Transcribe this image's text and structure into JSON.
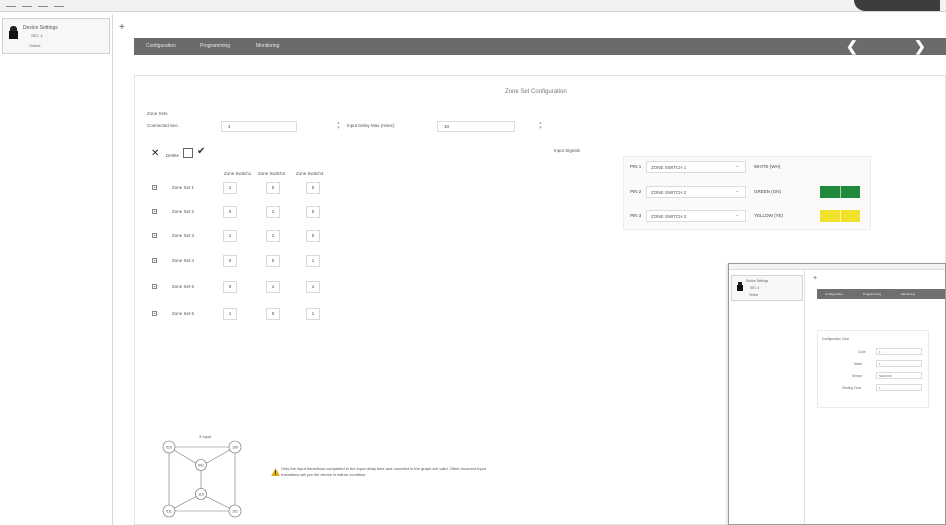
{
  "device": {
    "title": "Device Settings",
    "name": "SEC 4",
    "status": "Online",
    "add": "+"
  },
  "toolbar": {
    "tabs": [
      "Configuration",
      "Programming",
      "Monitoring"
    ],
    "back": "❮",
    "forward": "❯"
  },
  "page": {
    "title": "Zone Set Configuration"
  },
  "zone_sets": {
    "section_label": "Zone Sets",
    "connected_label": "Connected Sec.",
    "connected_value": "4",
    "delay_label": "Input Delay Max (msec)",
    "delay_value": "10",
    "delete_label": "Delete",
    "columns": [
      "Zone Switch1",
      "Zone Switch2",
      "Zone Switch3"
    ],
    "rows": [
      {
        "name": "Zone Set 1",
        "values": [
          "1",
          "0",
          "0"
        ]
      },
      {
        "name": "Zone Set 2",
        "values": [
          "0",
          "1",
          "0"
        ]
      },
      {
        "name": "Zone Set 3",
        "values": [
          "1",
          "1",
          "0"
        ]
      },
      {
        "name": "Zone Set 4",
        "values": [
          "0",
          "0",
          "1"
        ]
      },
      {
        "name": "Zone Set 5",
        "values": [
          "0",
          "1",
          "1"
        ]
      },
      {
        "name": "Zone Set 6",
        "values": [
          "1",
          "0",
          "1"
        ]
      }
    ]
  },
  "input_signals": {
    "label": "Input Signals",
    "rows": [
      {
        "pin": "PIN 1",
        "select": "ZONE SWITCH 1",
        "color": "WHITE (WH)",
        "swatch": null
      },
      {
        "pin": "PIN 2",
        "select": "ZONE SWITCH 2",
        "color": "GREEN (GN)",
        "swatch": "#1f8a3c"
      },
      {
        "pin": "PIN 3",
        "select": "ZONE SWITCH 3",
        "color": "YELLOW (YE)",
        "swatch": "#f2e12a"
      }
    ]
  },
  "diagram": {
    "title": "3 Input",
    "nodes": [
      "010",
      "100",
      "001",
      "110",
      "011",
      "101"
    ]
  },
  "warning": {
    "text": "Only the input transitions completed in the input delay time and mounted in the graph are valid. Other incorrect input transitions will put the device in failure condition."
  },
  "overlay": {
    "title": "Device Settings",
    "name": "SEC 4",
    "status": "Online",
    "add": "+",
    "tabs": [
      "Configuration",
      "Programming",
      "Monitoring"
    ],
    "panel_title": "Configuration Zone",
    "fields": [
      {
        "label": "Code",
        "value": "1"
      },
      {
        "label": "Mode",
        "value": "1"
      },
      {
        "label": "Sensor",
        "value": "SENSOR"
      },
      {
        "label": "Starting Zone",
        "value": "1"
      }
    ]
  }
}
